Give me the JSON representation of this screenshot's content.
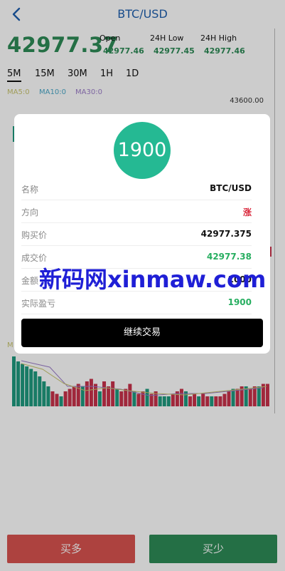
{
  "header": {
    "title": "BTC/USD",
    "back_icon": "chevron-left-icon"
  },
  "ticker": {
    "price": "42977.37",
    "open_label": "Open",
    "open_value": "42977.46",
    "low_label": "24H Low",
    "low_value": "42977.45",
    "high_label": "24H High",
    "high_value": "42977.46"
  },
  "tabs": [
    "5M",
    "15M",
    "30M",
    "1H",
    "1D"
  ],
  "active_tab": "5M",
  "ma": {
    "ma5": "MA5:0",
    "ma10": "MA10:0",
    "ma30": "MA30:0"
  },
  "chart": {
    "top_price": "43600.00",
    "partial_label": "M"
  },
  "chart_data": {
    "type": "bar",
    "title": "",
    "ylabel": "",
    "ylim": [
      0,
      10
    ],
    "values": [
      10,
      9,
      8.5,
      8,
      7.5,
      7,
      6,
      5,
      4,
      3,
      2.5,
      2,
      3,
      3.5,
      4,
      4.5,
      4,
      5,
      5.5,
      4.5,
      3,
      5,
      4,
      5,
      3.5,
      3,
      3.5,
      4.5,
      3,
      2.5,
      3,
      3.5,
      2.5,
      3,
      2,
      2,
      2,
      2.5,
      3,
      3.5,
      3,
      2,
      2.5,
      2,
      2.5,
      2,
      2,
      2,
      2,
      2.5,
      3,
      3.5,
      3.5,
      4,
      4,
      3.5,
      4,
      4,
      4.5,
      4.5
    ],
    "colors": [
      "g",
      "g",
      "g",
      "g",
      "g",
      "g",
      "g",
      "g",
      "g",
      "r",
      "r",
      "g",
      "r",
      "r",
      "r",
      "r",
      "g",
      "r",
      "r",
      "r",
      "g",
      "r",
      "r",
      "r",
      "g",
      "r",
      "r",
      "r",
      "g",
      "r",
      "r",
      "g",
      "r",
      "r",
      "g",
      "g",
      "g",
      "r",
      "r",
      "r",
      "g",
      "r",
      "r",
      "g",
      "r",
      "r",
      "g",
      "r",
      "r",
      "r",
      "r",
      "g",
      "r",
      "r",
      "g",
      "r",
      "r",
      "g",
      "r",
      "r"
    ],
    "green": "#1f9a7f",
    "red": "#c8314a"
  },
  "modal": {
    "profit_badge": "1900",
    "rows": [
      {
        "key": "名称",
        "value": "BTC/USD"
      },
      {
        "key": "方向",
        "value": "涨"
      },
      {
        "key": "购买价",
        "value": "42977.375"
      },
      {
        "key": "成交价",
        "value": "42977.38"
      },
      {
        "key": "金额",
        "value": "1000"
      },
      {
        "key": "实际盈亏",
        "value": "1900"
      }
    ],
    "continue_label": "继续交易"
  },
  "watermark": "新码网xinmaw.com",
  "buttons": {
    "buy_long": "买多",
    "buy_short": "买少"
  },
  "colors": {
    "green": "#2e8b57",
    "red": "#d9534f",
    "teal": "#25b993",
    "title_blue": "#1f5fae"
  }
}
